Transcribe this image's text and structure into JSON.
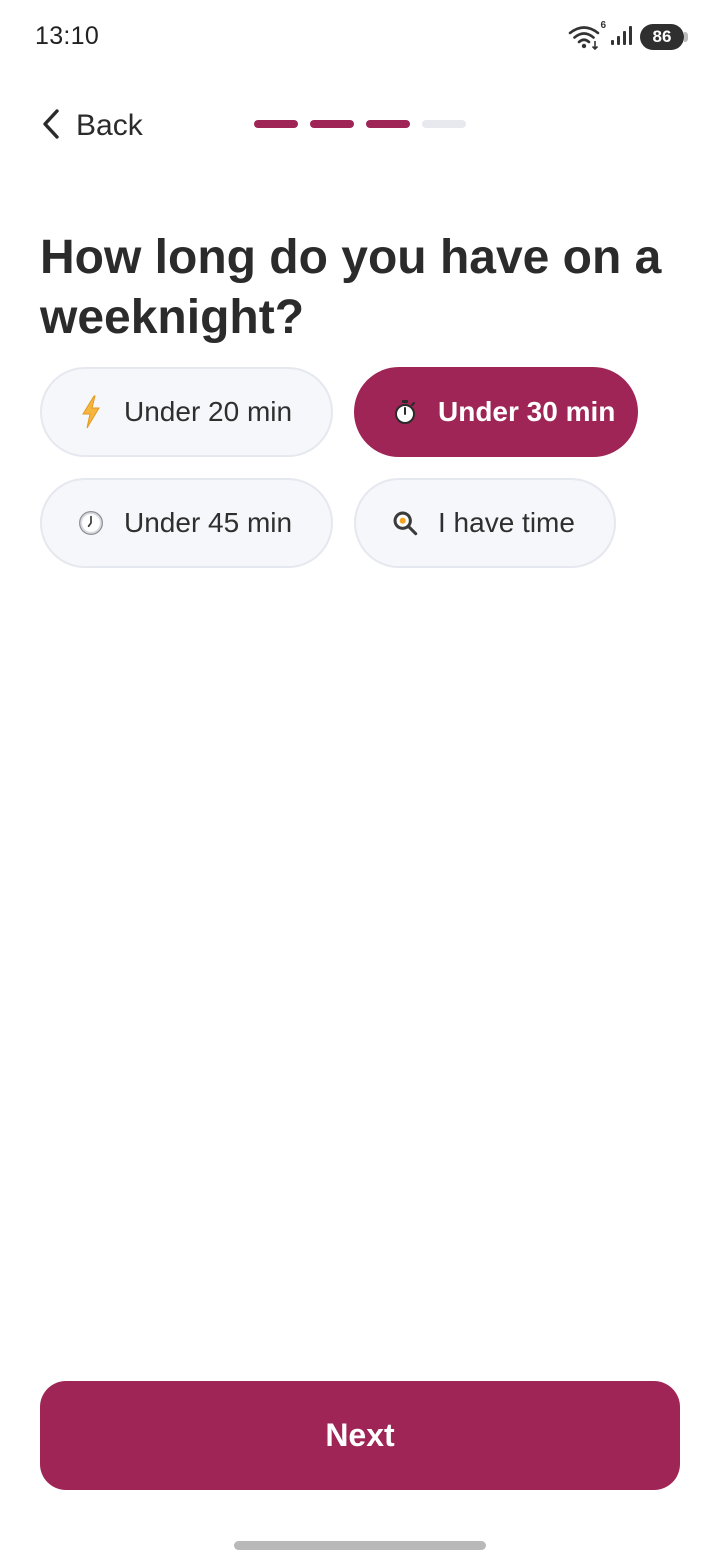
{
  "status_bar": {
    "time": "13:10",
    "wifi_badge": "6",
    "battery": "86",
    "icons": [
      "wifi-icon",
      "signal-icon",
      "battery-icon"
    ]
  },
  "header": {
    "back_label": "Back",
    "progress": {
      "completed_steps": 3,
      "total_steps": 4
    }
  },
  "question": "How long do you have on a weeknight?",
  "options": [
    {
      "label": "Under 20 min",
      "icon": "lightning-icon",
      "selected": false
    },
    {
      "label": "Under 30 min",
      "icon": "stopwatch-icon",
      "selected": true
    },
    {
      "label": "Under 45 min",
      "icon": "clock-icon",
      "selected": false
    },
    {
      "label": "I have time",
      "icon": "frying-pan-icon",
      "selected": false
    }
  ],
  "next_label": "Next",
  "colors": {
    "accent": "#9e2556",
    "chip_bg": "#f6f7fa",
    "chip_border": "#e6e8ef",
    "progress_inactive": "#e7e9ee",
    "text": "#2b2b2b"
  }
}
